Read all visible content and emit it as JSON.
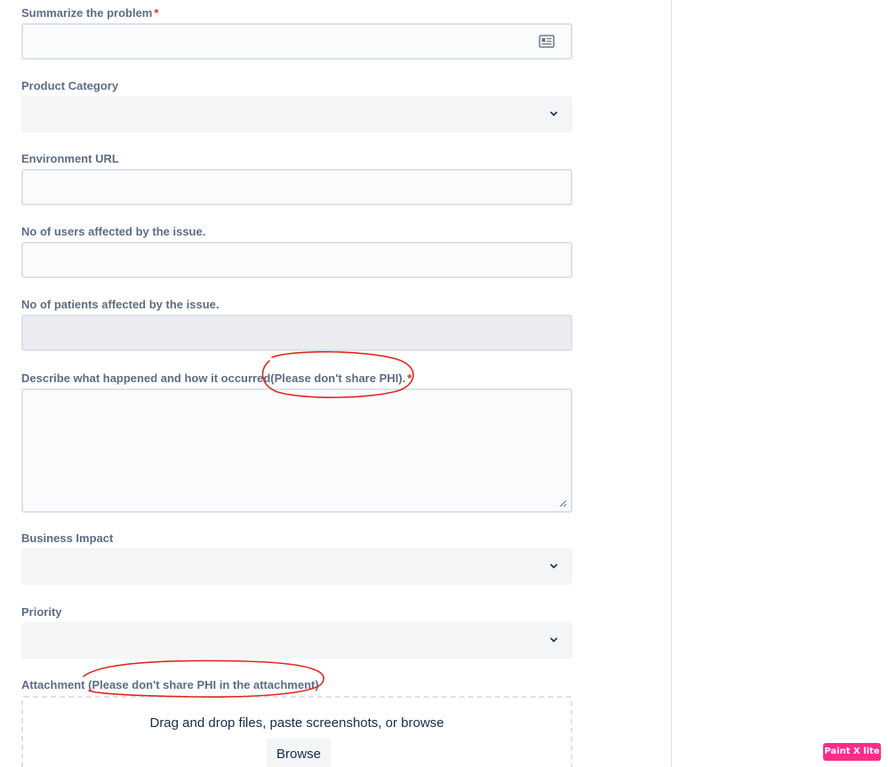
{
  "form": {
    "summary": {
      "label": "Summarize the problem",
      "required_mark": "*",
      "value": "",
      "icon": "id-card-icon"
    },
    "product_category": {
      "label": "Product Category",
      "value": "",
      "icon": "chevron-down-icon"
    },
    "environment_url": {
      "label": "Environment URL",
      "value": ""
    },
    "users_affected": {
      "label": "No of users affected by the issue.",
      "value": ""
    },
    "patients_affected": {
      "label": "No of patients affected by the issue.",
      "value": ""
    },
    "description": {
      "label_main": "Describe what happened and how it occurred",
      "label_note": "(Please don't share PHI).",
      "required_mark": "*",
      "value": ""
    },
    "business_impact": {
      "label": "Business Impact",
      "value": "",
      "icon": "chevron-down-icon"
    },
    "priority": {
      "label": "Priority",
      "value": "",
      "icon": "chevron-down-icon"
    },
    "attachment": {
      "label_main": "Attachment",
      "label_note": "(Please don't share PHI in the attachment)",
      "dropzone_text": "Drag and drop files, paste screenshots, or browse",
      "browse_label": "Browse"
    }
  },
  "annotations": {
    "color": "#e0281e",
    "shape": "hand-drawn ellipse"
  },
  "watermark": {
    "text": "Paint X lite",
    "color": "#ff2d8a"
  }
}
